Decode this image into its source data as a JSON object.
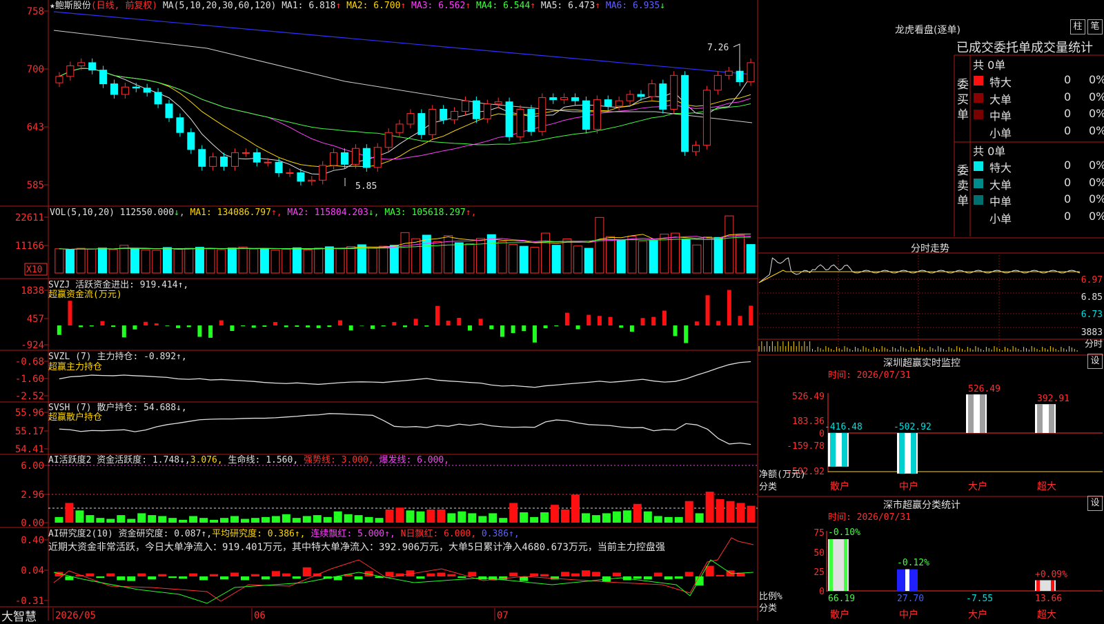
{
  "header": {
    "star": "★",
    "stock_name": "鲍斯股份",
    "period": "(日线, 前复权)",
    "ma_label": "MA(5,10,20,30,60,120)",
    "ma": [
      {
        "label": "MA1:",
        "value": "6.818",
        "arrow": "↑",
        "color": "#e0e0e0"
      },
      {
        "label": "MA2:",
        "value": "6.700",
        "arrow": "↑",
        "color": "#ffd800"
      },
      {
        "label": "MA3:",
        "value": "6.562",
        "arrow": "↑",
        "color": "#ff40ff"
      },
      {
        "label": "MA4:",
        "value": "6.544",
        "arrow": "↑",
        "color": "#40ff40"
      },
      {
        "label": "MA5:",
        "value": "6.473",
        "arrow": "↑",
        "color": "#e0e0e0"
      },
      {
        "label": "MA6:",
        "value": "6.935",
        "arrow": "↓",
        "color": "#6060ff"
      }
    ]
  },
  "main_axis": [
    "758",
    "700",
    "643",
    "585"
  ],
  "annotations": {
    "high": "7.26",
    "low": "5.85"
  },
  "vol": {
    "title": "VOL(5,10,20)",
    "value": "112550.000",
    "v_arrow": "↓",
    "ma": [
      {
        "label": "MA1:",
        "value": "134086.797",
        "arrow": "↑",
        "color": "#ffd800"
      },
      {
        "label": "MA2:",
        "value": "115804.203",
        "arrow": "↓",
        "color": "#ff40ff"
      },
      {
        "label": "MA3:",
        "value": "105618.297",
        "arrow": "↑",
        "color": "#40ff40"
      }
    ],
    "axis": [
      "22611",
      "11166"
    ],
    "unit": "X10"
  },
  "svzj": {
    "line1": "SVZJ  活跃资金进出: 919.414↑,",
    "line2": "超赢资金流(万元)",
    "axis": [
      "1838",
      "457",
      "-924"
    ]
  },
  "svzl": {
    "line1": "SVZL (7) 主力持仓: -0.892↑,",
    "line2": "超赢主力持仓",
    "axis": [
      "-0.68",
      "-1.60",
      "-2.52"
    ]
  },
  "svsh": {
    "line1": "SVSH (7) 散户持仓: 54.688↓,",
    "line2": "超赢散户持仓",
    "axis": [
      "55.96",
      "55.17",
      "54.41"
    ]
  },
  "ai1": {
    "t1": "AI活跃度2 资金活跃度: 1.748↓,",
    "t2": "3.076,",
    "t3": "生命线: 1.560,",
    "t4": "强势线: 3.000,",
    "t5": "爆发线: 6.000,",
    "axis": [
      "6.00",
      "2.96",
      "0.00"
    ]
  },
  "ai2": {
    "t1": "AI研究度2(10) 资金研究度: 0.087↑,",
    "t2": "平均研究度: 0.386↑,",
    "t3": "连续飘红: 5.000↑,",
    "t4": "N日飘红: 6.000,",
    "t5": "0.386↑,",
    "summary": "近期大资金非常活跃，今日大单净流入：919.401万元，其中特大单净流入：392.906万元，大单5日累计净入4680.673万元，当前主力控盘强",
    "axis": [
      "0.40",
      "0.04",
      "-0.31"
    ]
  },
  "xaxis": [
    "2026/05",
    "06",
    "07"
  ],
  "brand": "大智慧",
  "right": {
    "lhb_title": "龙虎看盘(逐单)",
    "btn1": "柱",
    "btn2": "笔",
    "tabs": "已成交委托单成交量统计",
    "buy": {
      "side": "委买单",
      "total": "共 0单",
      "rows": [
        {
          "name": "特大",
          "n": "0",
          "p": "0%"
        },
        {
          "name": "大单",
          "n": "0",
          "p": "0%"
        },
        {
          "name": "中单",
          "n": "0",
          "p": "0%"
        },
        {
          "name": "小单",
          "n": "0",
          "p": "0%"
        }
      ]
    },
    "sell": {
      "side": "委卖单",
      "total": "共 0单",
      "rows": [
        {
          "name": "特大",
          "n": "0",
          "p": "0%"
        },
        {
          "name": "大单",
          "n": "0",
          "p": "0%"
        },
        {
          "name": "中单",
          "n": "0",
          "p": "0%"
        },
        {
          "name": "小单",
          "n": "0",
          "p": "0%"
        }
      ]
    },
    "intraday": {
      "title": "分时走势",
      "axis": [
        "6.97",
        "6.85",
        "6.73"
      ],
      "vol": "3883",
      "vol_unit": "分时"
    },
    "monitor": {
      "title": "深圳超赢实时监控",
      "btn": "设",
      "time": "时间: 2026/07/31",
      "axis": [
        "526.49",
        "183.36",
        "0",
        "-159.78",
        "-502.92"
      ],
      "ylabel": "净额(万元)",
      "xlabel": "分类",
      "cats": [
        "散户",
        "中户",
        "大户",
        "超大"
      ],
      "values": [
        -416.48,
        -502.92,
        526.49,
        392.91
      ],
      "labels": [
        "-416.48",
        "-502.92",
        "526.49",
        "392.91"
      ]
    },
    "cls": {
      "title": "深市超赢分类统计",
      "btn": "设",
      "time": "时间: 2026/07/31",
      "axis": [
        "75",
        "50",
        "25",
        "0"
      ],
      "ylabel": "比例%",
      "xlabel": "分类",
      "cats": [
        "散户",
        "中户",
        "大户",
        "超大"
      ],
      "values": [
        66.19,
        27.7,
        -7.55,
        13.66
      ],
      "vlabels": [
        "66.19",
        "27.70",
        "-7.55",
        "13.66"
      ],
      "chg": [
        "-0.10%",
        "-0.12%",
        "",
        "+0.09%"
      ]
    }
  },
  "chart_data": [
    {
      "type": "candlestick",
      "title": "鲍斯股份",
      "ylim": [
        5.75,
        7.6
      ],
      "open": [
        6.87,
        6.93,
        7.03,
        7.06,
        6.99,
        6.86,
        6.76,
        6.83,
        6.82,
        6.78,
        6.67,
        6.54,
        6.4,
        6.24,
        6.08,
        6.17,
        6.08,
        6.21,
        6.21,
        6.12,
        6.12,
        6.02,
        6.02,
        5.94,
        5.95,
        6.09,
        6.21,
        6.1,
        6.25,
        6.07,
        6.26,
        6.4,
        6.48,
        6.58,
        6.38,
        6.62,
        6.52,
        6.6,
        6.7,
        6.53,
        6.67,
        6.69,
        6.36,
        6.62,
        6.41,
        6.73,
        6.71,
        6.73,
        6.7,
        6.43,
        6.71,
        6.65,
        6.7,
        6.76,
        6.74,
        6.86,
        6.62,
        6.94,
        6.22,
        6.28,
        6.8,
        6.94,
        6.98,
        6.88
      ],
      "close": [
        6.93,
        7.03,
        7.06,
        6.99,
        6.86,
        6.76,
        6.83,
        6.82,
        6.78,
        6.67,
        6.54,
        6.4,
        6.24,
        6.08,
        6.17,
        6.08,
        6.21,
        6.21,
        6.12,
        6.12,
        6.02,
        6.02,
        5.94,
        5.95,
        6.09,
        6.21,
        6.1,
        6.25,
        6.07,
        6.26,
        6.4,
        6.48,
        6.58,
        6.38,
        6.62,
        6.52,
        6.6,
        6.7,
        6.53,
        6.67,
        6.69,
        6.36,
        6.62,
        6.41,
        6.73,
        6.71,
        6.73,
        6.7,
        6.43,
        6.71,
        6.65,
        6.7,
        6.76,
        6.74,
        6.86,
        6.62,
        6.94,
        6.22,
        6.28,
        6.8,
        6.94,
        6.98,
        6.88,
        7.06
      ]
    },
    {
      "type": "bar",
      "title": "VOL(5,10,20)",
      "values": [
        9.6,
        9.2,
        9.8,
        9.5,
        9.9,
        9.3,
        11.0,
        9.7,
        9.2,
        9.0,
        10.1,
        9.4,
        9.8,
        10.2,
        9.6,
        9.3,
        9.9,
        10.3,
        9.5,
        9.7,
        9.1,
        9.4,
        10.0,
        9.2,
        9.9,
        10.4,
        9.6,
        10.5,
        11.2,
        9.8,
        10.6,
        11.0,
        16.0,
        13.6,
        15.0,
        12.4,
        14.8,
        12.0,
        11.6,
        13.7,
        15.2,
        12.5,
        11.3,
        10.6,
        10.2,
        15.8,
        11.0,
        13.5,
        10.7,
        9.8,
        22.0,
        14.4,
        13.0,
        14.6,
        12.6,
        12.8,
        15.4,
        15.8,
        13.4,
        11.1,
        14.3,
        14.1,
        22.6,
        15.0,
        11.3
      ]
    },
    {
      "type": "bar",
      "title": "SVZJ 活跃资金进出",
      "values": [
        -500,
        1300,
        -90,
        -50,
        230,
        -80,
        -630,
        -210,
        190,
        110,
        -30,
        -140,
        -90,
        -600,
        -650,
        270,
        -290,
        -40,
        -120,
        -70,
        180,
        -90,
        -70,
        -100,
        -140,
        -80,
        270,
        -260,
        -20,
        -180,
        -50,
        180,
        -90,
        350,
        -60,
        1030,
        250,
        400,
        -270,
        350,
        -200,
        -600,
        -400,
        -300,
        -900,
        -150,
        -40,
        670,
        -200,
        560,
        500,
        450,
        -120,
        -330,
        390,
        450,
        780,
        -560,
        -930,
        210,
        1590,
        240,
        1870,
        500,
        1040
      ]
    },
    {
      "type": "line",
      "title": "SVZL 主力持仓",
      "ylim": [
        -2.7,
        -0.6
      ],
      "values": [
        -1.7,
        -1.6,
        -1.57,
        -1.52,
        -1.54,
        -1.55,
        -1.52,
        -1.55,
        -1.57,
        -1.6,
        -1.63,
        -1.7,
        -1.72,
        -1.69,
        -1.75,
        -1.73,
        -1.76,
        -1.79,
        -1.82,
        -1.87,
        -1.9,
        -1.92,
        -1.89,
        -1.93,
        -1.96,
        -1.92,
        -1.88,
        -1.85,
        -1.84,
        -1.85,
        -1.87,
        -1.82,
        -1.78,
        -1.73,
        -1.68,
        -1.76,
        -1.8,
        -1.83,
        -1.87,
        -1.9,
        -1.99,
        -2.04,
        -2.02,
        -2.06,
        -2.1,
        -2.03,
        -1.99,
        -1.94,
        -1.9,
        -1.86,
        -1.81,
        -1.86,
        -1.82,
        -1.77,
        -1.72,
        -1.8,
        -1.85,
        -1.82,
        -1.7,
        -1.52,
        -1.36,
        -1.18,
        -1.02,
        -0.92,
        -0.88
      ]
    },
    {
      "type": "line",
      "title": "SVSH 散户持仓",
      "ylim": [
        54.3,
        56.1
      ],
      "values": [
        55.25,
        55.22,
        55.15,
        55.19,
        55.18,
        55.2,
        55.22,
        55.14,
        55.21,
        55.34,
        55.43,
        55.49,
        55.56,
        55.63,
        55.65,
        55.66,
        55.66,
        55.68,
        55.69,
        55.69,
        55.71,
        55.74,
        55.77,
        55.81,
        55.83,
        55.88,
        55.87,
        55.85,
        55.83,
        55.81,
        55.6,
        55.36,
        55.33,
        55.35,
        55.31,
        55.4,
        55.36,
        55.45,
        55.4,
        55.46,
        55.38,
        55.34,
        55.32,
        55.33,
        55.32,
        55.54,
        55.62,
        55.59,
        55.5,
        55.43,
        55.41,
        55.39,
        55.33,
        55.3,
        55.31,
        55.18,
        55.23,
        55.21,
        55.47,
        55.42,
        55.24,
        54.86,
        54.64,
        54.68,
        54.62
      ]
    },
    {
      "type": "bar",
      "title": "AI活跃度2",
      "values": [
        0.6,
        2.1,
        1.3,
        0.8,
        0.5,
        0.4,
        0.8,
        0.4,
        1.0,
        0.8,
        0.7,
        0.5,
        0.3,
        0.7,
        0.5,
        0.3,
        0.5,
        0.7,
        0.4,
        0.5,
        0.6,
        0.7,
        0.9,
        0.5,
        0.7,
        0.8,
        0.6,
        1.2,
        0.9,
        0.8,
        0.6,
        0.5,
        1.4,
        1.6,
        1.3,
        1.2,
        1.4,
        1.4,
        1.0,
        1.2,
        1.0,
        0.7,
        1.0,
        0.5,
        2.1,
        1.1,
        0.6,
        1.1,
        1.9,
        1.4,
        3.0,
        1.0,
        0.8,
        1.0,
        1.2,
        1.3,
        2.0,
        1.2,
        0.7,
        0.6,
        0.6,
        2.3,
        1.0,
        3.3,
        2.5,
        2.3,
        2.1,
        1.8
      ]
    },
    {
      "type": "bar",
      "title": "AI研究度2(10)",
      "values": [
        0.06,
        -0.05,
        0.02,
        0.04,
        -0.02,
        0.04,
        -0.05,
        -0.06,
        0.04,
        -0.04,
        0.03,
        -0.02,
        -0.03,
        0.04,
        -0.05,
        0.03,
        -0.04,
        0.05,
        -0.05,
        0.03,
        -0.04,
        0.07,
        0.04,
        -0.03,
        0.12,
        0.04,
        -0.03,
        -0.05,
        0.03,
        -0.04,
        0.07,
        -0.02,
        0.06,
        0.04,
        0.08,
        -0.03,
        0.04,
        0.05,
        0.03,
        -0.02,
        0.06,
        -0.04,
        -0.05,
        -0.04,
        0.05,
        -0.06,
        0.04,
        0.03,
        -0.04,
        0.06,
        0.04,
        0.08,
        0.06,
        -0.07,
        0.05,
        -0.05,
        -0.03,
        -0.04,
        0.05,
        -0.04,
        -0.03,
        0.06,
        -0.12,
        0.14,
        0.02,
        0.08,
        0.05
      ]
    }
  ]
}
